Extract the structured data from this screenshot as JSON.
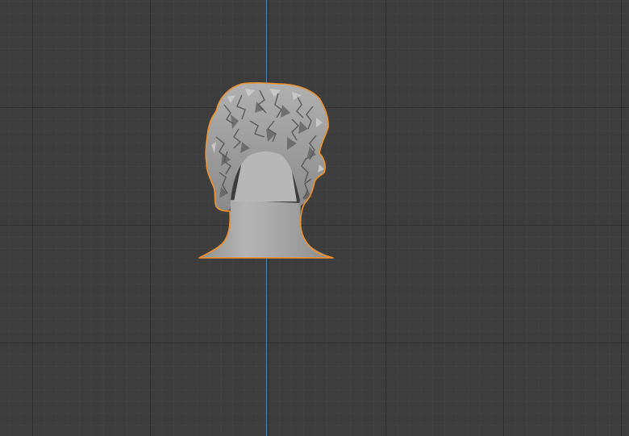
{
  "viewport": {
    "view": "orthographic-front",
    "background_color": "#3d3d3d",
    "grid_minor_color": "#464646",
    "grid_major_color": "#2e2e2e",
    "axis_z_color": "#4f7fb0"
  },
  "scene": {
    "selected_object": {
      "kind": "head-and-shoulders-sculpt-mesh",
      "selected": true,
      "outline_color": "#f0922b",
      "mesh_color": "#a8a8a8"
    }
  }
}
